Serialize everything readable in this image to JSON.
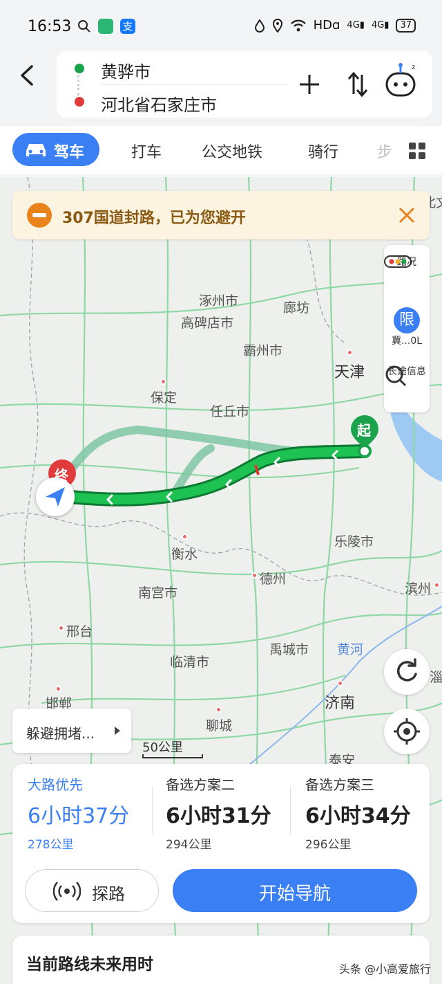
{
  "status_bar": {
    "time": "16:53",
    "network": "HDɑ",
    "signal1": "4G",
    "signal2": "4G",
    "battery": "37"
  },
  "route": {
    "origin": "黄骅市",
    "destination": "河北省石家庄市"
  },
  "tabs": {
    "active": "驾车",
    "items": [
      "打车",
      "公交地铁",
      "骑行",
      "步"
    ]
  },
  "banner": {
    "text": "307国道封路，已为您避开"
  },
  "side_panel": {
    "traffic": "路况",
    "restriction_badge": "限",
    "restriction": "冀...0L",
    "long_trip": "长途信息"
  },
  "map": {
    "cities": {
      "zhuozhou": "涿州市",
      "gaobeidian": "高碑店市",
      "langfang": "廊坊",
      "bazhou": "霸州市",
      "tianjin": "天津",
      "baoding": "保定",
      "renqiu": "任丘市",
      "hengshui": "衡水",
      "laoling": "乐陵市",
      "nangong": "南宫市",
      "dezhou": "德州",
      "binzhou": "滨州",
      "xingtai": "邢台",
      "linqing": "临清市",
      "yucheng": "禹城市",
      "huanghe": "黄河",
      "handan": "邯郸",
      "liaocheng": "聊城",
      "jinan": "济南",
      "taian": "泰安",
      "zibo_partial": "淄",
      "north_partial": "北文"
    },
    "start_label": "起",
    "end_label": "终",
    "avoid_button": "躲避拥堵...",
    "scale": "50公里"
  },
  "plans": [
    {
      "name": "大路优先",
      "time": "6小时37分",
      "distance": "278公里"
    },
    {
      "name": "备选方案二",
      "time": "6小时31分",
      "distance": "294公里"
    },
    {
      "name": "备选方案三",
      "time": "6小时34分",
      "distance": "296公里"
    }
  ],
  "actions": {
    "explore": "探路",
    "start_navigation": "开始导航"
  },
  "future": {
    "title": "当前路线未来用时"
  },
  "watermark": "头条 @小高爱旅行",
  "colors": {
    "accent": "#3b7ff5",
    "route_main": "#1aa34a",
    "route_alt": "#7fc6a4",
    "start_marker": "#1aa34a",
    "end_marker": "#e23b3b",
    "banner_bg": "#fdf3e1",
    "banner_icon": "#e8841b"
  }
}
